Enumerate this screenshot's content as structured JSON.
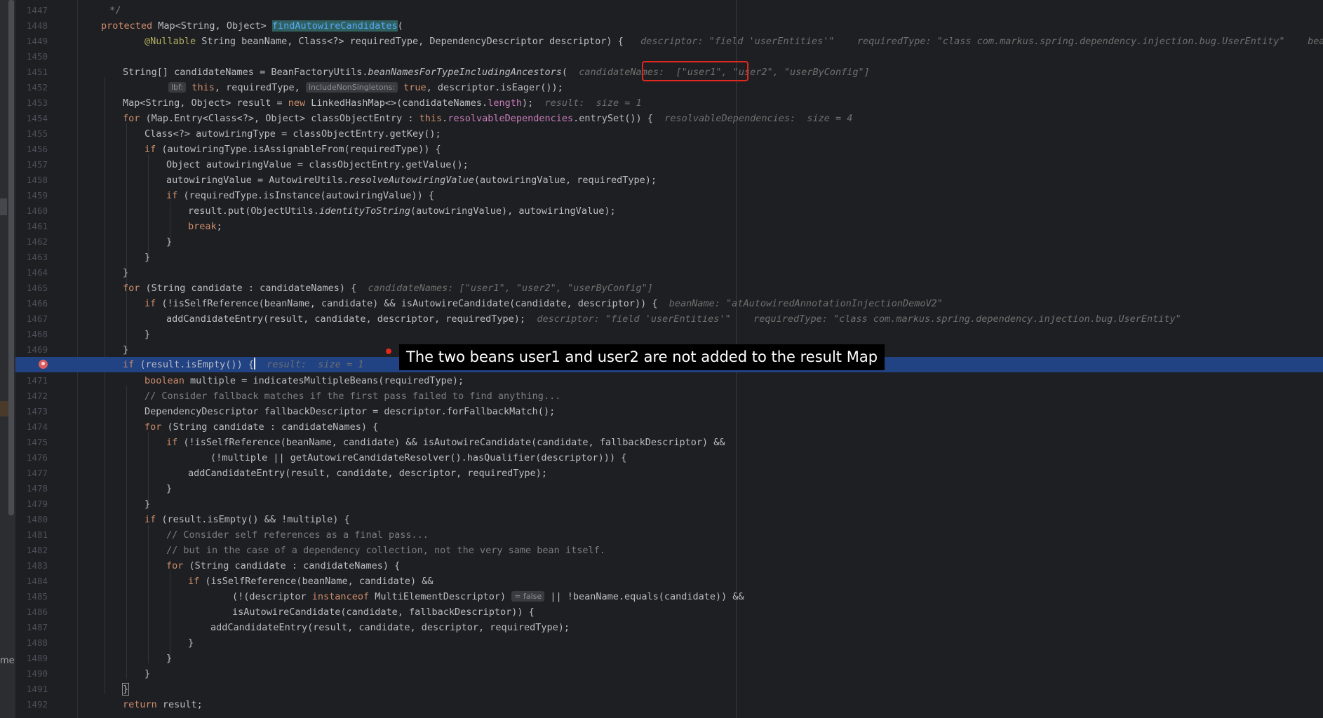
{
  "editor": {
    "side_label": "me",
    "lines": [
      {
        "n": "1447"
      },
      {
        "n": "1448"
      },
      {
        "n": "1449"
      },
      {
        "n": "1450"
      },
      {
        "n": "1451"
      },
      {
        "n": "1452"
      },
      {
        "n": "1453"
      },
      {
        "n": "1454"
      },
      {
        "n": "1455"
      },
      {
        "n": "1456"
      },
      {
        "n": "1457"
      },
      {
        "n": "1458"
      },
      {
        "n": "1459"
      },
      {
        "n": "1460"
      },
      {
        "n": "1461"
      },
      {
        "n": "1462"
      },
      {
        "n": "1463"
      },
      {
        "n": "1464"
      },
      {
        "n": "1465"
      },
      {
        "n": "1466"
      },
      {
        "n": "1467"
      },
      {
        "n": "1468"
      },
      {
        "n": "1469"
      },
      {
        "n": ""
      },
      {
        "n": "1471"
      },
      {
        "n": "1472"
      },
      {
        "n": "1473"
      },
      {
        "n": "1474"
      },
      {
        "n": "1475"
      },
      {
        "n": "1476"
      },
      {
        "n": "1477"
      },
      {
        "n": "1478"
      },
      {
        "n": "1479"
      },
      {
        "n": "1480"
      },
      {
        "n": "1481"
      },
      {
        "n": "1482"
      },
      {
        "n": "1483"
      },
      {
        "n": "1484"
      },
      {
        "n": "1485"
      },
      {
        "n": "1486"
      },
      {
        "n": "1487"
      },
      {
        "n": "1488"
      },
      {
        "n": "1489"
      },
      {
        "n": "1490"
      },
      {
        "n": "1491"
      },
      {
        "n": "1492"
      }
    ],
    "code": {
      "l1447_comment": " */",
      "l1448_kw": "protected",
      "l1448_a": " Map<String, Object> ",
      "l1448_method": "findAutowireCandidates",
      "l1448_b": "(",
      "l1449_ann": "@Nullable",
      "l1449_a": " String beanName, Class<?> requiredType, DependencyDescriptor descriptor) {",
      "l1449_hint": "descriptor: \"field 'userEntities'\"    requiredType: \"class com.markus.spring.dependency.injection.bug.UserEntity\"    beanName: \"a",
      "l1451_a": "String[] candidateNames = BeanFactoryUtils.",
      "l1451_m": "beanNamesForTypeIncludingAncestors",
      "l1451_b": "(",
      "l1451_hint1": "candidateNames:",
      "l1451_hint2": "[\"user1\", \"user2\", \"userByConfig\"]",
      "l1452_param1": "lbf:",
      "l1452_kw1": "this",
      "l1452_a": ", requiredType, ",
      "l1452_param2": "includeNonSingletons:",
      "l1452_kw2": "true",
      "l1452_b": ", descriptor.isEager());",
      "l1453_a": "Map<String, Object> result = ",
      "l1453_kw": "new",
      "l1453_b": " LinkedHashMap<>(candidateNames.",
      "l1453_fld": "length",
      "l1453_c": ");",
      "l1453_hint": "result:  size = 1",
      "l1454_kw": "for",
      "l1454_a": " (Map.Entry<Class<?>, Object> classObjectEntry : ",
      "l1454_kw2": "this",
      "l1454_b": ".",
      "l1454_fld": "resolvableDependencies",
      "l1454_c": ".entrySet()) {",
      "l1454_hint": "resolvableDependencies:  size = 4",
      "l1455": "Class<?> autowiringType = classObjectEntry.getKey();",
      "l1456_kw": "if",
      "l1456_a": " (autowiringType.isAssignableFrom(requiredType)) {",
      "l1457": "Object autowiringValue = classObjectEntry.getValue();",
      "l1458_a": "autowiringValue = AutowireUtils.",
      "l1458_m": "resolveAutowiringValue",
      "l1458_b": "(autowiringValue, requiredType);",
      "l1459_kw": "if",
      "l1459_a": " (requiredType.isInstance(autowiringValue)) {",
      "l1460_a": "result.put(ObjectUtils.",
      "l1460_m": "identityToString",
      "l1460_b": "(autowiringValue), autowiringValue);",
      "l1461_kw": "break",
      "l1461_a": ";",
      "close": "}",
      "l1465_kw": "for",
      "l1465_a": " (String candidate : candidateNames) {",
      "l1465_hint": "candidateNames: [\"user1\", \"user2\", \"userByConfig\"]",
      "l1466_kw": "if",
      "l1466_a": " (!isSelfReference(beanName, candidate) && isAutowireCandidate(candidate, descriptor)) {",
      "l1466_hint": "beanName: \"atAutowiredAnnotationInjectionDemoV2\"",
      "l1467_a": "addCandidateEntry(result, candidate, descriptor, requiredType);",
      "l1467_hint": "descriptor: \"field 'userEntities'\"    requiredType: \"class com.markus.spring.dependency.injection.bug.UserEntity\"",
      "l1470_kw": "if",
      "l1470_a": " (result.isEmpty()) {",
      "l1470_hint": "result:  size = 1",
      "l1471_kw": "boolean",
      "l1471_a": " multiple = indicatesMultipleBeans(requiredType);",
      "l1472_cm": "// Consider fallback matches if the first pass failed to find anything...",
      "l1473": "DependencyDescriptor fallbackDescriptor = descriptor.forFallbackMatch();",
      "l1474_kw": "for",
      "l1474_a": " (String candidate : candidateNames) {",
      "l1475_kw": "if",
      "l1475_a": " (!isSelfReference(beanName, candidate) && isAutowireCandidate(candidate, fallbackDescriptor) &&",
      "l1476": "(!multiple || getAutowireCandidateResolver().hasQualifier(descriptor))) {",
      "l1477": "addCandidateEntry(result, candidate, descriptor, requiredType);",
      "l1480_kw": "if",
      "l1480_a": " (result.isEmpty() && !multiple) {",
      "l1481_cm": "// Consider self references as a final pass...",
      "l1482_cm": "// but in the case of a dependency collection, not the very same bean itself.",
      "l1483_kw": "for",
      "l1483_a": " (String candidate : candidateNames) {",
      "l1484_kw": "if",
      "l1484_a": " (isSelfReference(beanName, candidate) &&",
      "l1485_a": "(!(descriptor ",
      "l1485_kw": "instanceof",
      "l1485_b": " MultiElementDescriptor)",
      "l1485_pill": "= false",
      "l1485_c": " || !beanName.equals(candidate)) &&",
      "l1486": "isAutowireCandidate(candidate, fallbackDescriptor)) {",
      "l1487": "addCandidateEntry(result, candidate, descriptor, requiredType);",
      "l1492_kw": "return",
      "l1492_a": " result;"
    }
  },
  "annotation": {
    "callout_text": "The two beans user1 and user2 are not added to the result Map",
    "highlight_color": "#e0281f"
  }
}
